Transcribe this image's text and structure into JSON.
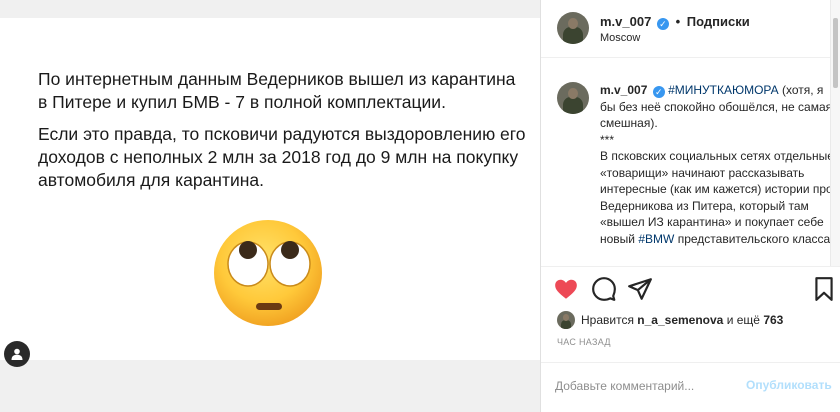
{
  "post": {
    "paragraph1": "По интернетным данным Ведерников вышел из карантина в Питере и купил БМВ - 7 в полной комплектации.",
    "paragraph2": "Если это правда, то псковичи радуются выздоровлению его доходов с неполных 2 млн за 2018 год до 9 млн на покупку автомобиля для карантина.",
    "emoji": "rolling-eyes-emoji"
  },
  "header": {
    "username": "m.v_007",
    "verified_mark": "✓",
    "separator": "•",
    "follow_label": "Подписки",
    "location": "Moscow"
  },
  "caption": {
    "username": "m.v_007",
    "hashtag1": "#МИНУТКАЮМОРА",
    "line1": "(хотя, я бы без неё спокойно обошёлся, не самая смешная).",
    "stars": "***",
    "body": "В псковских социальных сетях отдельные «товарищи» начинают рассказывать интересные (как им кажется) истории про Ведерникова из Питера, который там «вышел ИЗ карантина» и покупает себе новый",
    "hashtag2": "#BMW",
    "tail": "представительского класса."
  },
  "likes": {
    "prefix": "Нравится",
    "liker": "n_a_semenova",
    "middle": "и ещё",
    "count": "763"
  },
  "time": "ЧАС НАЗАД",
  "comment": {
    "placeholder": "Добавьте комментарий...",
    "publish_label": "Опубликовать"
  },
  "colors": {
    "like_red": "#ed4956",
    "link_blue": "#00376b",
    "verified_blue": "#3897f0",
    "publish_disabled": "#b2dffc"
  }
}
